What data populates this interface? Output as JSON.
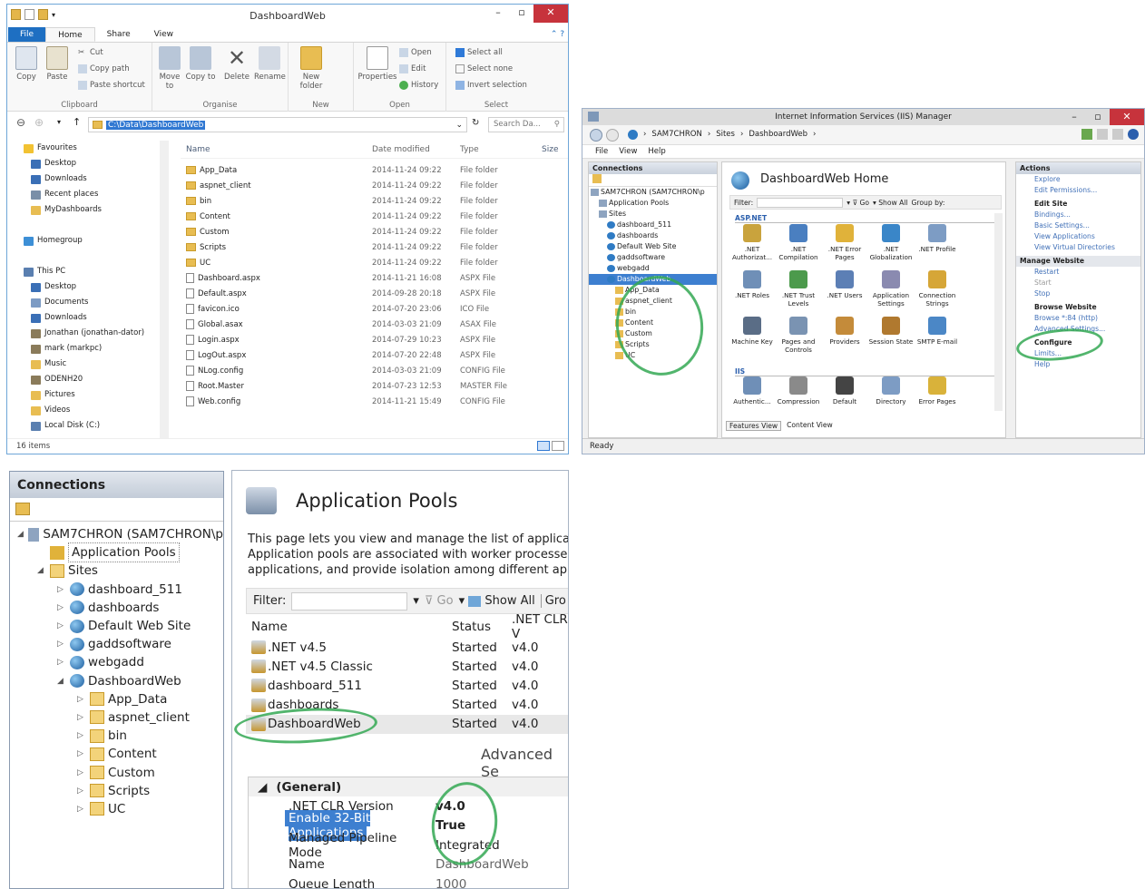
{
  "explorer": {
    "title": "DashboardWeb",
    "tabs": [
      "File",
      "Home",
      "Share",
      "View"
    ],
    "ribbon": {
      "groups": [
        "Clipboard",
        "Organise",
        "New",
        "Open",
        "Select"
      ],
      "copy": "Copy",
      "paste": "Paste",
      "cut": "Cut",
      "copy_path": "Copy path",
      "paste_shortcut": "Paste shortcut",
      "move_to": "Move to",
      "copy_to": "Copy to",
      "delete": "Delete",
      "rename": "Rename",
      "new_folder": "New folder",
      "properties": "Properties",
      "open": "Open",
      "edit": "Edit",
      "history": "History",
      "select_all": "Select all",
      "select_none": "Select none",
      "invert_selection": "Invert selection"
    },
    "address": "C:\\Data\\DashboardWeb",
    "search_placeholder": "Search Da...",
    "nav": [
      {
        "label": "Favourites",
        "color": "#f2c232",
        "indent": 0
      },
      {
        "label": "Desktop",
        "color": "#3a6fb6",
        "indent": 1
      },
      {
        "label": "Downloads",
        "color": "#3a6fb6",
        "indent": 1
      },
      {
        "label": "Recent places",
        "color": "#7a8fa8",
        "indent": 1
      },
      {
        "label": "MyDashboards",
        "color": "#e8bd52",
        "indent": 1
      },
      {
        "label": "",
        "color": "",
        "indent": 0
      },
      {
        "label": "Homegroup",
        "color": "#3d8fd6",
        "indent": 0
      },
      {
        "label": "",
        "color": "",
        "indent": 0
      },
      {
        "label": "This PC",
        "color": "#5a7fb0",
        "indent": 0
      },
      {
        "label": "Desktop",
        "color": "#3a6fb6",
        "indent": 1
      },
      {
        "label": "Documents",
        "color": "#7c9bc4",
        "indent": 1
      },
      {
        "label": "Downloads",
        "color": "#3a6fb6",
        "indent": 1
      },
      {
        "label": "Jonathan (jonathan-dator)",
        "color": "#8a7b5a",
        "indent": 1
      },
      {
        "label": "mark (markpc)",
        "color": "#8a7b5a",
        "indent": 1
      },
      {
        "label": "Music",
        "color": "#e8bd52",
        "indent": 1
      },
      {
        "label": "ODENH20",
        "color": "#8a7b5a",
        "indent": 1
      },
      {
        "label": "Pictures",
        "color": "#e8bd52",
        "indent": 1
      },
      {
        "label": "Videos",
        "color": "#e8bd52",
        "indent": 1
      },
      {
        "label": "Local Disk (C:)",
        "color": "#5a7fb0",
        "indent": 1
      }
    ],
    "columns": [
      "Name",
      "Date modified",
      "Type",
      "Size"
    ],
    "files": [
      {
        "name": "App_Data",
        "date": "2014-11-24 09:22",
        "type": "File folder",
        "kind": "folder"
      },
      {
        "name": "aspnet_client",
        "date": "2014-11-24 09:22",
        "type": "File folder",
        "kind": "folder"
      },
      {
        "name": "bin",
        "date": "2014-11-24 09:22",
        "type": "File folder",
        "kind": "folder"
      },
      {
        "name": "Content",
        "date": "2014-11-24 09:22",
        "type": "File folder",
        "kind": "folder"
      },
      {
        "name": "Custom",
        "date": "2014-11-24 09:22",
        "type": "File folder",
        "kind": "folder"
      },
      {
        "name": "Scripts",
        "date": "2014-11-24 09:22",
        "type": "File folder",
        "kind": "folder"
      },
      {
        "name": "UC",
        "date": "2014-11-24 09:22",
        "type": "File folder",
        "kind": "folder"
      },
      {
        "name": "Dashboard.aspx",
        "date": "2014-11-21 16:08",
        "type": "ASPX File",
        "kind": "doc"
      },
      {
        "name": "Default.aspx",
        "date": "2014-09-28 20:18",
        "type": "ASPX File",
        "kind": "doc"
      },
      {
        "name": "favicon.ico",
        "date": "2014-07-20 23:06",
        "type": "ICO File",
        "kind": "doc"
      },
      {
        "name": "Global.asax",
        "date": "2014-03-03 21:09",
        "type": "ASAX File",
        "kind": "doc"
      },
      {
        "name": "Login.aspx",
        "date": "2014-07-29 10:23",
        "type": "ASPX File",
        "kind": "doc"
      },
      {
        "name": "LogOut.aspx",
        "date": "2014-07-20 22:48",
        "type": "ASPX File",
        "kind": "doc"
      },
      {
        "name": "NLog.config",
        "date": "2014-03-03 21:09",
        "type": "CONFIG File",
        "kind": "doc"
      },
      {
        "name": "Root.Master",
        "date": "2014-07-23 12:53",
        "type": "MASTER File",
        "kind": "doc"
      },
      {
        "name": "Web.config",
        "date": "2014-11-21 15:49",
        "type": "CONFIG File",
        "kind": "doc"
      }
    ],
    "status": "16 items"
  },
  "iis": {
    "title": "Internet Information Services (IIS) Manager",
    "breadcrumb": [
      "SAM7CHRON",
      "Sites",
      "DashboardWeb"
    ],
    "menu": [
      "File",
      "View",
      "Help"
    ],
    "connections_title": "Connections",
    "tree": [
      {
        "label": "SAM7CHRON (SAM7CHRON\\p",
        "indent": 0
      },
      {
        "label": "Application Pools",
        "indent": 1
      },
      {
        "label": "Sites",
        "indent": 1
      },
      {
        "label": "dashboard_511",
        "indent": 2
      },
      {
        "label": "dashboards",
        "indent": 2
      },
      {
        "label": "Default Web Site",
        "indent": 2
      },
      {
        "label": "gaddsoftware",
        "indent": 2
      },
      {
        "label": "webgadd",
        "indent": 2
      },
      {
        "label": "DashboardWeb",
        "indent": 2
      },
      {
        "label": "App_Data",
        "indent": 3
      },
      {
        "label": "aspnet_client",
        "indent": 3
      },
      {
        "label": "bin",
        "indent": 3
      },
      {
        "label": "Content",
        "indent": 3
      },
      {
        "label": "Custom",
        "indent": 3
      },
      {
        "label": "Scripts",
        "indent": 3
      },
      {
        "label": "UC",
        "indent": 3
      }
    ],
    "home_title": "DashboardWeb Home",
    "filter_label": "Filter:",
    "go": "Go",
    "show_all": "Show All",
    "group_by": "Group by:",
    "section_aspnet": "ASP.NET",
    "section_iis": "IIS",
    "features": [
      ".NET Authorizat...",
      ".NET Compilation",
      ".NET Error Pages",
      ".NET Globalization",
      ".NET Profile",
      ".NET Roles",
      ".NET Trust Levels",
      ".NET Users",
      "Application Settings",
      "Connection Strings",
      "Machine Key",
      "Pages and Controls",
      "Providers",
      "Session State",
      "SMTP E-mail"
    ],
    "iis_features": [
      "Authentic...",
      "Compression",
      "Default",
      "Directory",
      "Error Pages"
    ],
    "views": [
      "Features View",
      "Content View"
    ],
    "actions_title": "Actions",
    "actions": [
      {
        "label": "Explore",
        "style": "link"
      },
      {
        "label": "Edit Permissions...",
        "style": "link"
      },
      {
        "label": "Edit Site",
        "style": "head"
      },
      {
        "label": "Bindings...",
        "style": "link"
      },
      {
        "label": "Basic Settings...",
        "style": "link"
      },
      {
        "label": "View Applications",
        "style": "link"
      },
      {
        "label": "View Virtual Directories",
        "style": "link"
      },
      {
        "label": "Manage Website",
        "style": "sec"
      },
      {
        "label": "Restart",
        "style": "link"
      },
      {
        "label": "Start",
        "style": "dim"
      },
      {
        "label": "Stop",
        "style": "link"
      },
      {
        "label": "Browse Website",
        "style": "head"
      },
      {
        "label": "Browse *:84 (http)",
        "style": "link"
      },
      {
        "label": "Advanced Settings...",
        "style": "link"
      },
      {
        "label": "Configure",
        "style": "head"
      },
      {
        "label": "Limits...",
        "style": "link"
      },
      {
        "label": "Help",
        "style": "link"
      }
    ],
    "status": "Ready"
  },
  "conn2": {
    "title": "Connections",
    "tree": [
      {
        "label": "SAM7CHRON (SAM7CHRON\\p",
        "indent": 0,
        "kind": "server"
      },
      {
        "label": "Application Pools",
        "indent": 1,
        "kind": "pool"
      },
      {
        "label": "Sites",
        "indent": 1,
        "kind": "folder"
      },
      {
        "label": "dashboard_511",
        "indent": 2,
        "kind": "globe"
      },
      {
        "label": "dashboards",
        "indent": 2,
        "kind": "globe"
      },
      {
        "label": "Default Web Site",
        "indent": 2,
        "kind": "globe"
      },
      {
        "label": "gaddsoftware",
        "indent": 2,
        "kind": "globe"
      },
      {
        "label": "webgadd",
        "indent": 2,
        "kind": "globe"
      },
      {
        "label": "DashboardWeb",
        "indent": 2,
        "kind": "globe"
      },
      {
        "label": "App_Data",
        "indent": 3,
        "kind": "folder"
      },
      {
        "label": "aspnet_client",
        "indent": 3,
        "kind": "folder"
      },
      {
        "label": "bin",
        "indent": 3,
        "kind": "folder"
      },
      {
        "label": "Content",
        "indent": 3,
        "kind": "folder"
      },
      {
        "label": "Custom",
        "indent": 3,
        "kind": "folder"
      },
      {
        "label": "Scripts",
        "indent": 3,
        "kind": "folder"
      },
      {
        "label": "UC",
        "indent": 3,
        "kind": "folder"
      }
    ]
  },
  "apppools": {
    "title": "Application Pools",
    "desc": [
      "This page lets you view and manage the list of application p",
      "Application pools are associated with worker processes, con",
      "applications, and provide isolation among different applicat"
    ],
    "filter_label": "Filter:",
    "go": "Go",
    "show_all": "Show All",
    "group": "Gro",
    "columns": [
      "Name",
      "Status",
      ".NET CLR V"
    ],
    "rows": [
      {
        "name": ".NET v4.5",
        "status": "Started",
        "clr": "v4.0"
      },
      {
        "name": ".NET v4.5 Classic",
        "status": "Started",
        "clr": "v4.0"
      },
      {
        "name": "dashboard_511",
        "status": "Started",
        "clr": "v4.0"
      },
      {
        "name": "dashboards",
        "status": "Started",
        "clr": "v4.0"
      },
      {
        "name": "DashboardWeb",
        "status": "Started",
        "clr": "v4.0"
      }
    ],
    "advanced_title": "Advanced Se",
    "props_section": "(General)",
    "props": [
      {
        "name": ".NET CLR Version",
        "value": "v4.0",
        "bold": true
      },
      {
        "name": "Enable 32-Bit Applications",
        "value": "True",
        "bold": true
      },
      {
        "name": "Managed Pipeline Mode",
        "value": "Integrated",
        "bold": false
      },
      {
        "name": "Name",
        "value": "DashboardWeb",
        "bold": false
      },
      {
        "name": "Queue Length",
        "value": "1000",
        "bold": false
      }
    ]
  }
}
